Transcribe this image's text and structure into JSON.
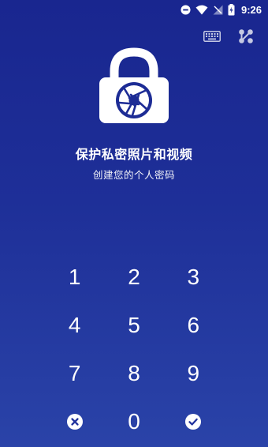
{
  "status_bar": {
    "time": "9:26",
    "icons": [
      "do-not-disturb-icon",
      "wifi-icon",
      "no-signal-icon",
      "battery-charging-icon"
    ]
  },
  "top_actions": {
    "icons": [
      "keyboard-icon",
      "pattern-icon"
    ]
  },
  "lock": {
    "icon": "camera-aperture-lock-icon"
  },
  "title": "保护私密照片和视频",
  "subtitle": "创建您的个人密码",
  "keypad": {
    "keys": [
      "1",
      "2",
      "3",
      "4",
      "5",
      "6",
      "7",
      "8",
      "9",
      "",
      "0",
      ""
    ],
    "clear_icon": "clear-x-circle-icon",
    "confirm_icon": "confirm-check-circle-icon"
  },
  "colors": {
    "background_top": "#19268f",
    "background_bottom": "#2a43a8",
    "foreground": "#ffffff"
  }
}
